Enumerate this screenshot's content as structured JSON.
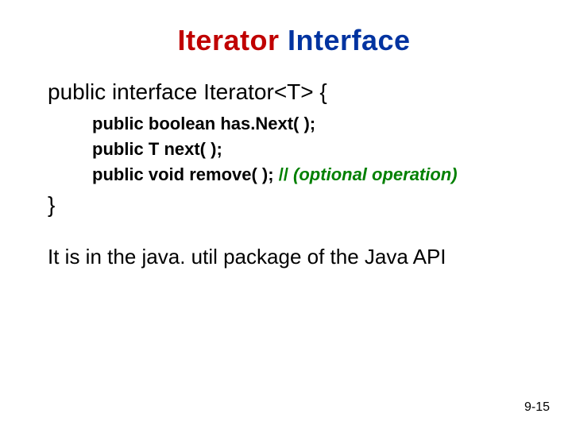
{
  "title": {
    "part1": "Iterator ",
    "part2": "Interface"
  },
  "declaration": "public interface Iterator<T> {",
  "methods": {
    "m1": "public boolean has.Next( );",
    "m2": "public T next( );",
    "m3_prefix": "public void remove( ); ",
    "m3_comment_slashes": "// ",
    "m3_comment_text": "(optional operation)"
  },
  "close_brace": "}",
  "body": "It is in the java. util package of the Java API",
  "page_number": "9-15"
}
